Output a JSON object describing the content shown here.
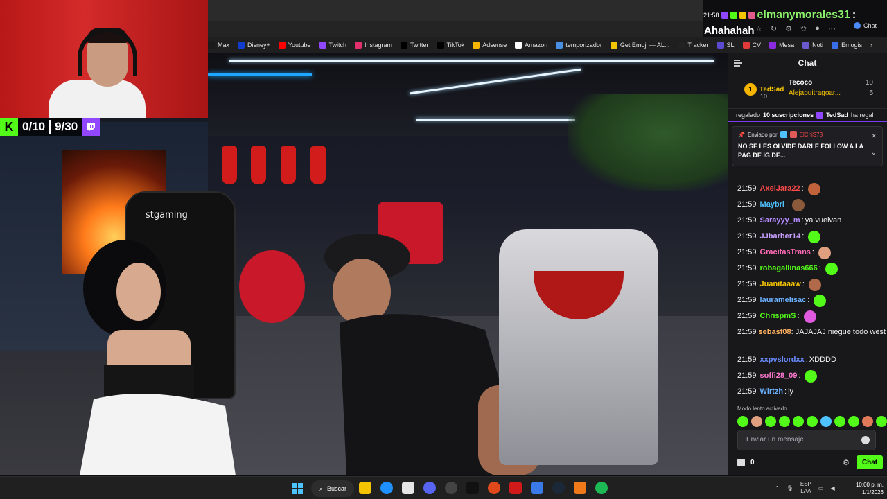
{
  "bookmarks": [
    {
      "label": "Max",
      "color": "#1a1a1a"
    },
    {
      "label": "Disney+",
      "color": "#113ccf"
    },
    {
      "label": "Youtube",
      "color": "#ff0000"
    },
    {
      "label": "Twitch",
      "color": "#9146ff"
    },
    {
      "label": "Instagram",
      "color": "#e1306c"
    },
    {
      "label": "Twitter",
      "color": "#000000"
    },
    {
      "label": "TikTok",
      "color": "#000000"
    },
    {
      "label": "Adsense",
      "color": "#f4b400"
    },
    {
      "label": "Amazon",
      "color": "#ffffff"
    },
    {
      "label": "temporizador",
      "color": "#4a90e2"
    },
    {
      "label": "Get Emoji — AL...",
      "color": "#f5c400"
    },
    {
      "label": "Tracker",
      "color": "#222222"
    },
    {
      "label": "SL",
      "color": "#5a4bd1"
    },
    {
      "label": "CV",
      "color": "#e03a3a"
    },
    {
      "label": "Mesa",
      "color": "#8a2be2"
    },
    {
      "label": "Noti",
      "color": "#6a5acd"
    },
    {
      "label": "Emogis",
      "color": "#3a6ee8"
    }
  ],
  "overlay": {
    "kick_count": "0/10",
    "twitch_count": "9/30",
    "kick_letter": "K",
    "chair_brand": "stgaming"
  },
  "top_alert": {
    "time": "21:58",
    "user": "elmanymorales31",
    "colon": ":",
    "message": "Ahahahah",
    "chat_tab": "Chat"
  },
  "chat": {
    "title": "Chat",
    "leaderboard": {
      "rank": "1",
      "top_name": "TedSad",
      "top_value": "10",
      "rows": [
        {
          "name": "Tecoco",
          "value": "10"
        },
        {
          "name": "Alejabuitragoar...",
          "value": "5"
        }
      ]
    },
    "sub_banner": {
      "text1": "regalado",
      "count": "10 suscripciones",
      "text2": "TedSad",
      "text3": "ha regal"
    },
    "pinned": {
      "label": "Enviado por",
      "by": "ElChiS73",
      "message": "NO SE LES OLVIDE DARLE FOLLOW A LA PAG DE IG DE..."
    },
    "messages": [
      {
        "time": "21:59",
        "user": "AxelJara22",
        "color": "#ff4a4a",
        "text": "",
        "emote": "#c0623a"
      },
      {
        "time": "21:59",
        "user": "Maybri",
        "color": "#4fc3ff",
        "text": "",
        "emote": "#8a5a3a"
      },
      {
        "time": "21:59",
        "user": "Sarayyy_m",
        "color": "#b48cff",
        "text": "ya vuelvan",
        "emote": ""
      },
      {
        "time": "21:59",
        "user": "JJbarber14",
        "color": "#c8a0ff",
        "text": "",
        "emote": "#53fc18"
      },
      {
        "time": "21:59",
        "user": "GracitasTrans",
        "color": "#ff6ab4",
        "text": "",
        "emote": "#e0a080"
      },
      {
        "time": "21:59",
        "user": "robagallinas666",
        "color": "#53fc18",
        "text": "",
        "emote": "#53fc18"
      },
      {
        "time": "21:59",
        "user": "Juanitaaaw",
        "color": "#f5c400",
        "text": "",
        "emote": "#b06a4a"
      },
      {
        "time": "21:59",
        "user": "lauramelisac",
        "color": "#6ab0ff",
        "text": "",
        "emote": "#53fc18"
      },
      {
        "time": "21:59",
        "user": "ChrispmS",
        "color": "#53fc18",
        "text": "",
        "emote": "#e05ae0"
      },
      {
        "time": "21:59",
        "user": "sebasf08",
        "color": "#ffb060",
        "text": "JAJAJAJ niegue todo west",
        "emote": ""
      },
      {
        "time": "21:59",
        "user": "xxpvslordxx",
        "color": "#6a8cff",
        "text": "XDDDD",
        "emote": ""
      },
      {
        "time": "21:59",
        "user": "soffi28_09",
        "color": "#ff7ad0",
        "text": "",
        "emote": "#53fc18"
      },
      {
        "time": "21:59",
        "user": "Wirtzh",
        "color": "#6ab0ff",
        "text": "iy",
        "emote": ""
      }
    ],
    "slow_mode": "Modo lento activado",
    "input_placeholder": "Enviar un mensaje",
    "points": "0",
    "send_label": "Chat"
  },
  "taskbar": {
    "search_label": "Buscar",
    "lang_top": "ESP",
    "lang_bottom": "LAA",
    "time": "10:00 p. m.",
    "date": "1/1/2026"
  }
}
